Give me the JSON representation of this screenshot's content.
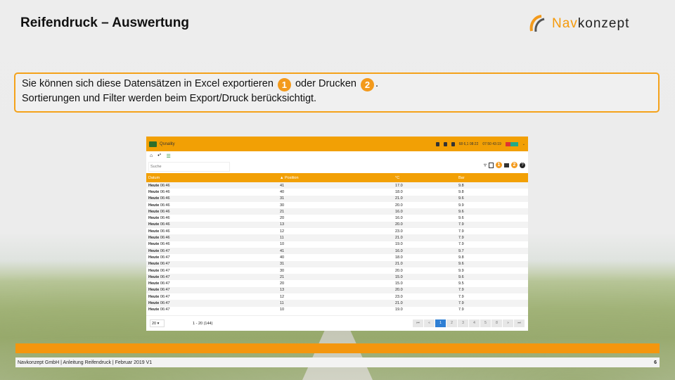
{
  "header": {
    "title": "Reifendruck – Auswertung"
  },
  "logo": {
    "text_part1": "Nav",
    "text_part2": "konzept"
  },
  "info": {
    "line1_a": "Sie können sich diese Datensätzen in Excel exportieren",
    "badge1": "1",
    "line1_b": "oder Drucken",
    "badge2": "2",
    "line1_c": ".",
    "line2": "Sortierungen und Filter werden beim Export/Druck berücksichtigt."
  },
  "app": {
    "vehicle_label": "Qsnality",
    "topbar_time1": "07:50",
    "topbar_time2": "43:19",
    "topbar_val1": "68",
    "topbar_val2": "6,1",
    "topbar_time3": "08:22",
    "search_placeholder": "Suche",
    "tool_badge1": "1",
    "tool_badge2": "2",
    "columns": [
      "Datum",
      "Position",
      "°C",
      "Bar"
    ],
    "rows": [
      {
        "date": "Heute",
        "time": "06:46",
        "position": "41",
        "temp": "17.0",
        "bar": "9.8"
      },
      {
        "date": "Heute",
        "time": "06:46",
        "position": "40",
        "temp": "18.0",
        "bar": "9.8"
      },
      {
        "date": "Heute",
        "time": "06:46",
        "position": "31",
        "temp": "21.0",
        "bar": "9.6"
      },
      {
        "date": "Heute",
        "time": "06:46",
        "position": "30",
        "temp": "20.0",
        "bar": "9.9"
      },
      {
        "date": "Heute",
        "time": "06:46",
        "position": "21",
        "temp": "16.0",
        "bar": "9.6"
      },
      {
        "date": "Heute",
        "time": "06:46",
        "position": "20",
        "temp": "16.0",
        "bar": "9.6"
      },
      {
        "date": "Heute",
        "time": "06:46",
        "position": "13",
        "temp": "20.0",
        "bar": "7.9"
      },
      {
        "date": "Heute",
        "time": "06:46",
        "position": "12",
        "temp": "23.0",
        "bar": "7.9"
      },
      {
        "date": "Heute",
        "time": "06:46",
        "position": "11",
        "temp": "21.0",
        "bar": "7.9"
      },
      {
        "date": "Heute",
        "time": "06:46",
        "position": "10",
        "temp": "19.0",
        "bar": "7.9"
      },
      {
        "date": "Heute",
        "time": "06:47",
        "position": "41",
        "temp": "16.0",
        "bar": "9.7"
      },
      {
        "date": "Heute",
        "time": "06:47",
        "position": "40",
        "temp": "18.0",
        "bar": "9.8"
      },
      {
        "date": "Heute",
        "time": "06:47",
        "position": "31",
        "temp": "21.0",
        "bar": "9.6"
      },
      {
        "date": "Heute",
        "time": "06:47",
        "position": "30",
        "temp": "20.0",
        "bar": "9.9"
      },
      {
        "date": "Heute",
        "time": "06:47",
        "position": "21",
        "temp": "15.0",
        "bar": "9.6"
      },
      {
        "date": "Heute",
        "time": "06:47",
        "position": "20",
        "temp": "15.0",
        "bar": "9.5"
      },
      {
        "date": "Heute",
        "time": "06:47",
        "position": "13",
        "temp": "20.0",
        "bar": "7.9"
      },
      {
        "date": "Heute",
        "time": "06:47",
        "position": "12",
        "temp": "23.0",
        "bar": "7.9"
      },
      {
        "date": "Heute",
        "time": "06:47",
        "position": "11",
        "temp": "21.0",
        "bar": "7.9"
      },
      {
        "date": "Heute",
        "time": "06:47",
        "position": "10",
        "temp": "19.0",
        "bar": "7.9"
      }
    ],
    "page_size": "20",
    "range_text": "1 - 20 (144)",
    "pages": [
      "⏮",
      "«",
      "1",
      "2",
      "3",
      "4",
      "5",
      "8",
      "»",
      "⏭"
    ],
    "active_page": "1"
  },
  "footer": {
    "text": "Navkonzept GmbH  |  Anleitung Reifendruck  |  Februar 2019 V1",
    "page_number": "6"
  },
  "colors": {
    "accent": "#f4960e",
    "table_header": "#f2a005",
    "active_page": "#2f7fd4"
  }
}
